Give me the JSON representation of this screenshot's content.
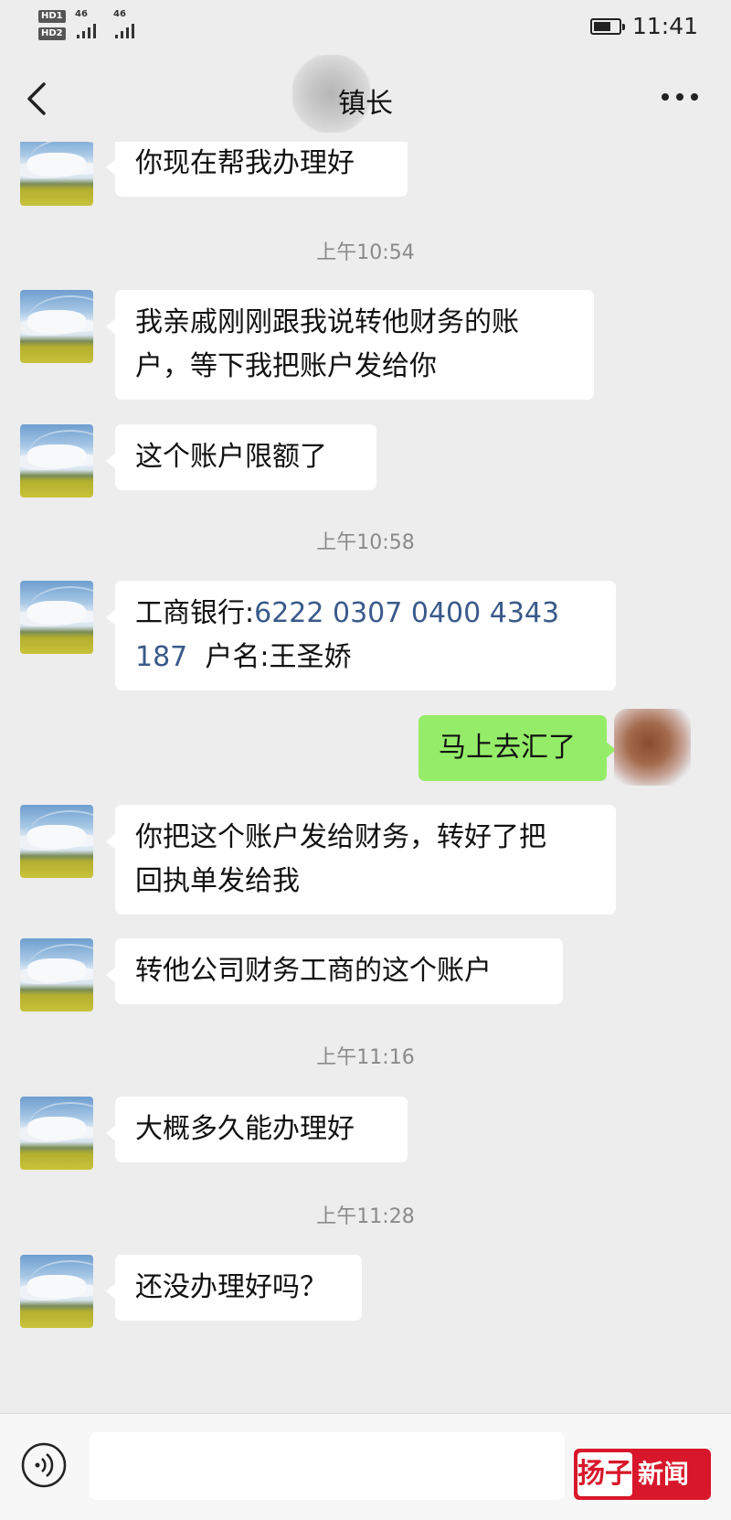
{
  "statusbar": {
    "network_badges": [
      "HD1",
      "HD2"
    ],
    "signal_labels": [
      "46",
      "46"
    ],
    "time": "11:41",
    "battery_level": 0.6
  },
  "header": {
    "title": "镇长",
    "back_icon": "chevron-left-icon",
    "more_icon": "ellipsis-icon"
  },
  "messages": [
    {
      "type": "in",
      "text": "你现在帮我办理好"
    },
    {
      "type": "time",
      "text": "上午10:54"
    },
    {
      "type": "in",
      "line1": "我亲戚刚刚跟我说转他财务的账",
      "line2": "户，等下我把账户发给你"
    },
    {
      "type": "in",
      "text": "这个账户限额了"
    },
    {
      "type": "time",
      "text": "上午10:58"
    },
    {
      "type": "in",
      "bank_label": "工商银行:",
      "account_part1": "6222 0307 0400 4343",
      "account_part2": "187",
      "name_label": "户名:王圣娇"
    },
    {
      "type": "out",
      "text": "马上去汇了"
    },
    {
      "type": "in",
      "line1": "你把这个账户发给财务，转好了把",
      "line2": "回执单发给我"
    },
    {
      "type": "in",
      "text": "转他公司财务工商的这个账户"
    },
    {
      "type": "time",
      "text": "上午11:16"
    },
    {
      "type": "in",
      "text": "大概多久能办理好"
    },
    {
      "type": "time",
      "text": "上午11:28"
    },
    {
      "type": "in",
      "text": "还没办理好吗？"
    }
  ],
  "inputbar": {
    "voice_icon": "voice-icon",
    "input_value": "",
    "watermark_logo": "扬子",
    "watermark_text": "新闻"
  },
  "colors": {
    "background": "#ededed",
    "incoming_bubble": "#ffffff",
    "outgoing_bubble": "#95ec69",
    "link_text": "#3a5a8a",
    "timestamp_text": "#8a8a8a",
    "watermark": "#d8172a"
  }
}
